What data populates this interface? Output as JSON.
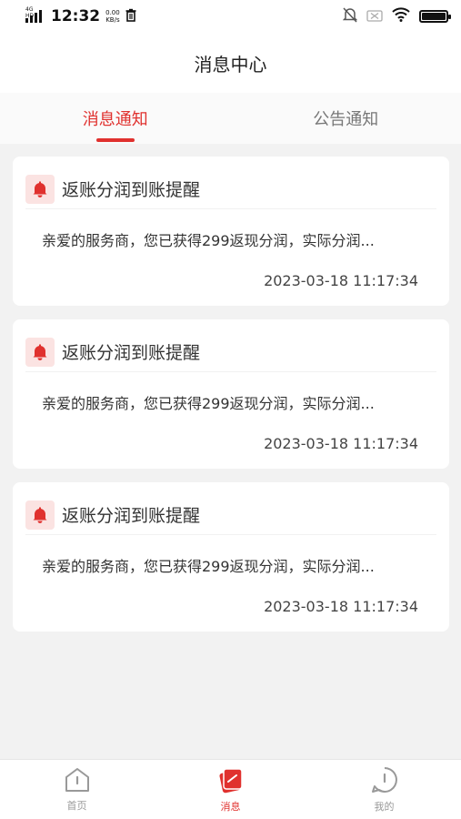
{
  "status_bar": {
    "network": "4G HD",
    "time": "12:32",
    "speed_value": "0.00",
    "speed_unit": "KB/s"
  },
  "header": {
    "title": "消息中心"
  },
  "tabs": [
    {
      "label": "消息通知",
      "active": true
    },
    {
      "label": "公告通知",
      "active": false
    }
  ],
  "messages": [
    {
      "title": "返账分润到账提醒",
      "body": "亲爱的服务商，您已获得299返现分润，实际分润...",
      "time": "2023-03-18 11:17:34"
    },
    {
      "title": "返账分润到账提醒",
      "body": "亲爱的服务商，您已获得299返现分润，实际分润...",
      "time": "2023-03-18 11:17:34"
    },
    {
      "title": "返账分润到账提醒",
      "body": "亲爱的服务商，您已获得299返现分润，实际分润...",
      "time": "2023-03-18 11:17:34"
    }
  ],
  "bottom_nav": [
    {
      "label": "首页",
      "icon": "home-icon",
      "active": false
    },
    {
      "label": "消息",
      "icon": "message-icon",
      "active": true
    },
    {
      "label": "我的",
      "icon": "profile-icon",
      "active": false
    }
  ],
  "colors": {
    "accent": "#e0312e",
    "bell_bg": "#fbe3e2",
    "page_bg": "#f2f2f2"
  }
}
